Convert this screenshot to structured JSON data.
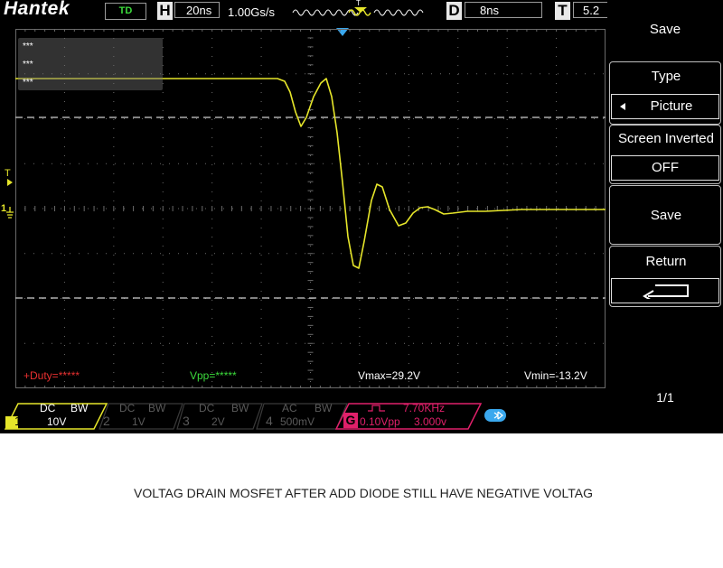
{
  "brand": "Hantek",
  "topbar": {
    "mode": "TD",
    "h_letter": "H",
    "timebase": "20ns",
    "sample_rate": "1.00Gs/s",
    "trig_pos_marker": "T",
    "d_letter": "D",
    "delay": "8ns",
    "t_letter": "T",
    "trigger_level": "5.2"
  },
  "overlay_lines": [
    "***",
    "***",
    "***"
  ],
  "measurements": {
    "duty": "+Duty=*****",
    "vpp": "Vpp=*****",
    "vmax": "Vmax=29.2V",
    "vmin": "Vmin=-13.2V"
  },
  "left_markers": {
    "trigger": "T",
    "ch1": "1"
  },
  "menu": {
    "title": "Save",
    "type_label": "Type",
    "type_value": "Picture",
    "inverted_label": "Screen Inverted",
    "inverted_value": "OFF",
    "save_label": "Save",
    "return_label": "Return",
    "page": "1/1"
  },
  "channels": [
    {
      "num": "1",
      "coupling": "DC",
      "bw": "BW",
      "scale": "10V",
      "color": "#e6e62a"
    },
    {
      "num": "2",
      "coupling": "DC",
      "bw": "BW",
      "scale": "1V",
      "color": "#5a5a5a"
    },
    {
      "num": "3",
      "coupling": "DC",
      "bw": "BW",
      "scale": "2V",
      "color": "#5a5a5a"
    },
    {
      "num": "4",
      "coupling": "AC",
      "bw": "BW",
      "scale": "500mV",
      "color": "#5a5a5a"
    }
  ],
  "generator": {
    "letter": "G",
    "freq": "7.70KHz",
    "amplitude": "0.10Vpp",
    "offset": "3.000v",
    "color": "#e0206a"
  },
  "caption": "VOLTAG DRAIN MOSFET AFTER ADD DIODE STILL HAVE NEGATIVE VOLTAG",
  "colors": {
    "trace": "#e6e62a",
    "measure_red": "#e83030",
    "measure_green": "#3cdc3c",
    "measure_white": "#ffffff",
    "grid": "#6a6a6a",
    "accent_blue": "#3aa8ee"
  }
}
